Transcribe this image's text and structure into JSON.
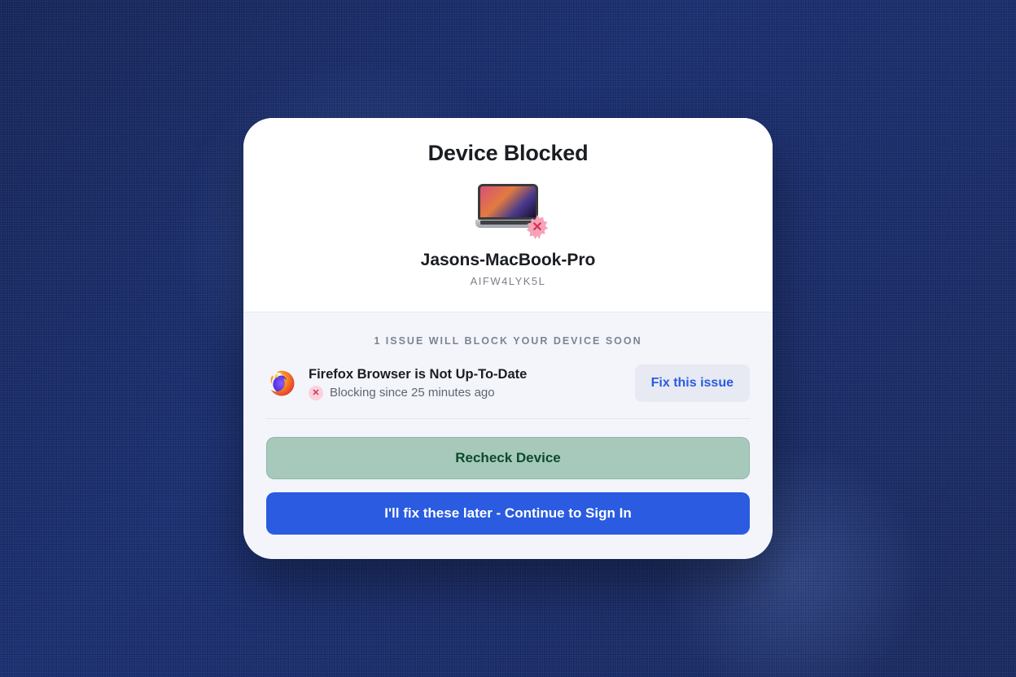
{
  "header": {
    "title": "Device Blocked",
    "device_name": "Jasons-MacBook-Pro",
    "device_id": "AIFW4LYK5L"
  },
  "issues_section": {
    "heading": "1 ISSUE WILL BLOCK YOUR DEVICE SOON",
    "items": [
      {
        "icon": "firefox-icon",
        "title": "Firefox Browser is Not Up-To-Date",
        "status": "Blocking since 25 minutes ago",
        "fix_label": "Fix this issue"
      }
    ]
  },
  "actions": {
    "recheck_label": "Recheck Device",
    "continue_label": "I'll fix these later - Continue to Sign In"
  },
  "colors": {
    "primary_blue": "#2a5be0",
    "recheck_green": "#a6c9bb",
    "error_pink": "#d6305a"
  }
}
